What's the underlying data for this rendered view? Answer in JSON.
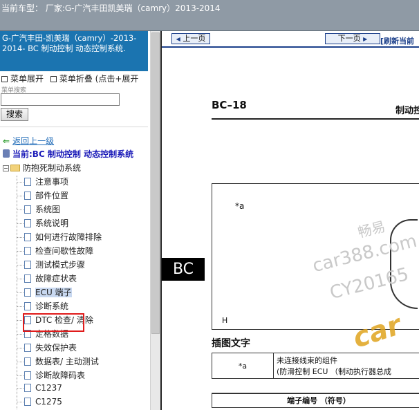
{
  "header": {
    "title": "当前车型：  厂家:G-广汽丰田凯美瑞（camry）2013-2014"
  },
  "sidebar": {
    "heading": "G-广汽丰田-凯美瑞（camry）-2013-2014- BC 制动控制 动态控制系统.",
    "menu_expand": "菜单展开",
    "menu_collapse": "菜单折叠 (点击+展开",
    "search_label": "菜单搜索",
    "search_value": "",
    "search_button": "搜索",
    "back_link": "返回上一级",
    "current": "当前:BC 制动控制 动态控制系统",
    "root_folder": "防抱死制动系统",
    "items": [
      {
        "label": "注意事项"
      },
      {
        "label": "部件位置"
      },
      {
        "label": "系统图"
      },
      {
        "label": "系统说明"
      },
      {
        "label": "如何进行故障排除"
      },
      {
        "label": "检查间歇性故障"
      },
      {
        "label": "测试模式步骤"
      },
      {
        "label": "故障症状表"
      },
      {
        "label": "ECU 端子"
      },
      {
        "label": "诊断系统"
      },
      {
        "label": "DTC 检查/ 清除"
      },
      {
        "label": "定格数据"
      },
      {
        "label": "失效保护表"
      },
      {
        "label": "数据表/ 主动测试"
      },
      {
        "label": "诊断故障码表"
      },
      {
        "label": "C1237"
      },
      {
        "label": "C1275"
      }
    ],
    "selected_item": "ECU 端子"
  },
  "content": {
    "prev_button": "上一页",
    "next_button": "下一页",
    "refresh": "[刷新当前",
    "page_code": "BC–18",
    "section": "制动控",
    "figure_label_a": "*a",
    "figure_label_h": "H",
    "side_tab": "BC",
    "watermark_1": "畅易",
    "watermark_2": "car388.com",
    "watermark_3": "CY20165",
    "logo_text": "car",
    "legend_title": "插图文字",
    "legend_key": "*a",
    "legend_text_1": "未连接线束的组件",
    "legend_text_2": "(防滑控制 ECU （制动执行器总成",
    "terminal_header": "端子编号 （符号）"
  }
}
